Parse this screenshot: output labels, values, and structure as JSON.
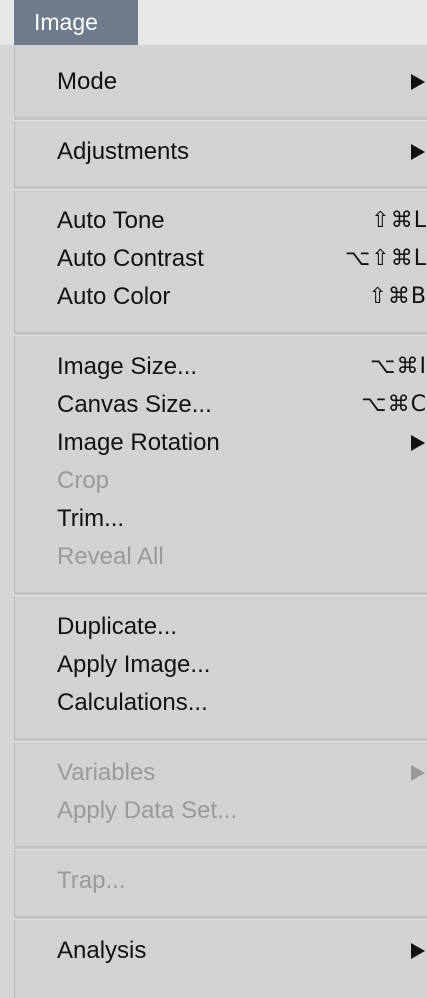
{
  "menubar": {
    "title": "Image"
  },
  "menu": {
    "mode": {
      "label": "Mode"
    },
    "adjustments": {
      "label": "Adjustments"
    },
    "auto_tone": {
      "label": "Auto Tone",
      "shortcut": "⇧⌘L"
    },
    "auto_contrast": {
      "label": "Auto Contrast",
      "shortcut": "⌥⇧⌘L"
    },
    "auto_color": {
      "label": "Auto Color",
      "shortcut": "⇧⌘B"
    },
    "image_size": {
      "label": "Image Size...",
      "shortcut": "⌥⌘I"
    },
    "canvas_size": {
      "label": "Canvas Size...",
      "shortcut": "⌥⌘C"
    },
    "image_rotation": {
      "label": "Image Rotation"
    },
    "crop": {
      "label": "Crop"
    },
    "trim": {
      "label": "Trim..."
    },
    "reveal_all": {
      "label": "Reveal All"
    },
    "duplicate": {
      "label": "Duplicate..."
    },
    "apply_image": {
      "label": "Apply Image..."
    },
    "calculations": {
      "label": "Calculations..."
    },
    "variables": {
      "label": "Variables"
    },
    "apply_data_set": {
      "label": "Apply Data Set..."
    },
    "trap": {
      "label": "Trap..."
    },
    "analysis": {
      "label": "Analysis"
    }
  },
  "colors": {
    "menubar_highlight": "#6f7c8c",
    "menu_background": "#d2d2d2",
    "enabled_text": "#111111",
    "disabled_text": "#9a9a9a"
  }
}
